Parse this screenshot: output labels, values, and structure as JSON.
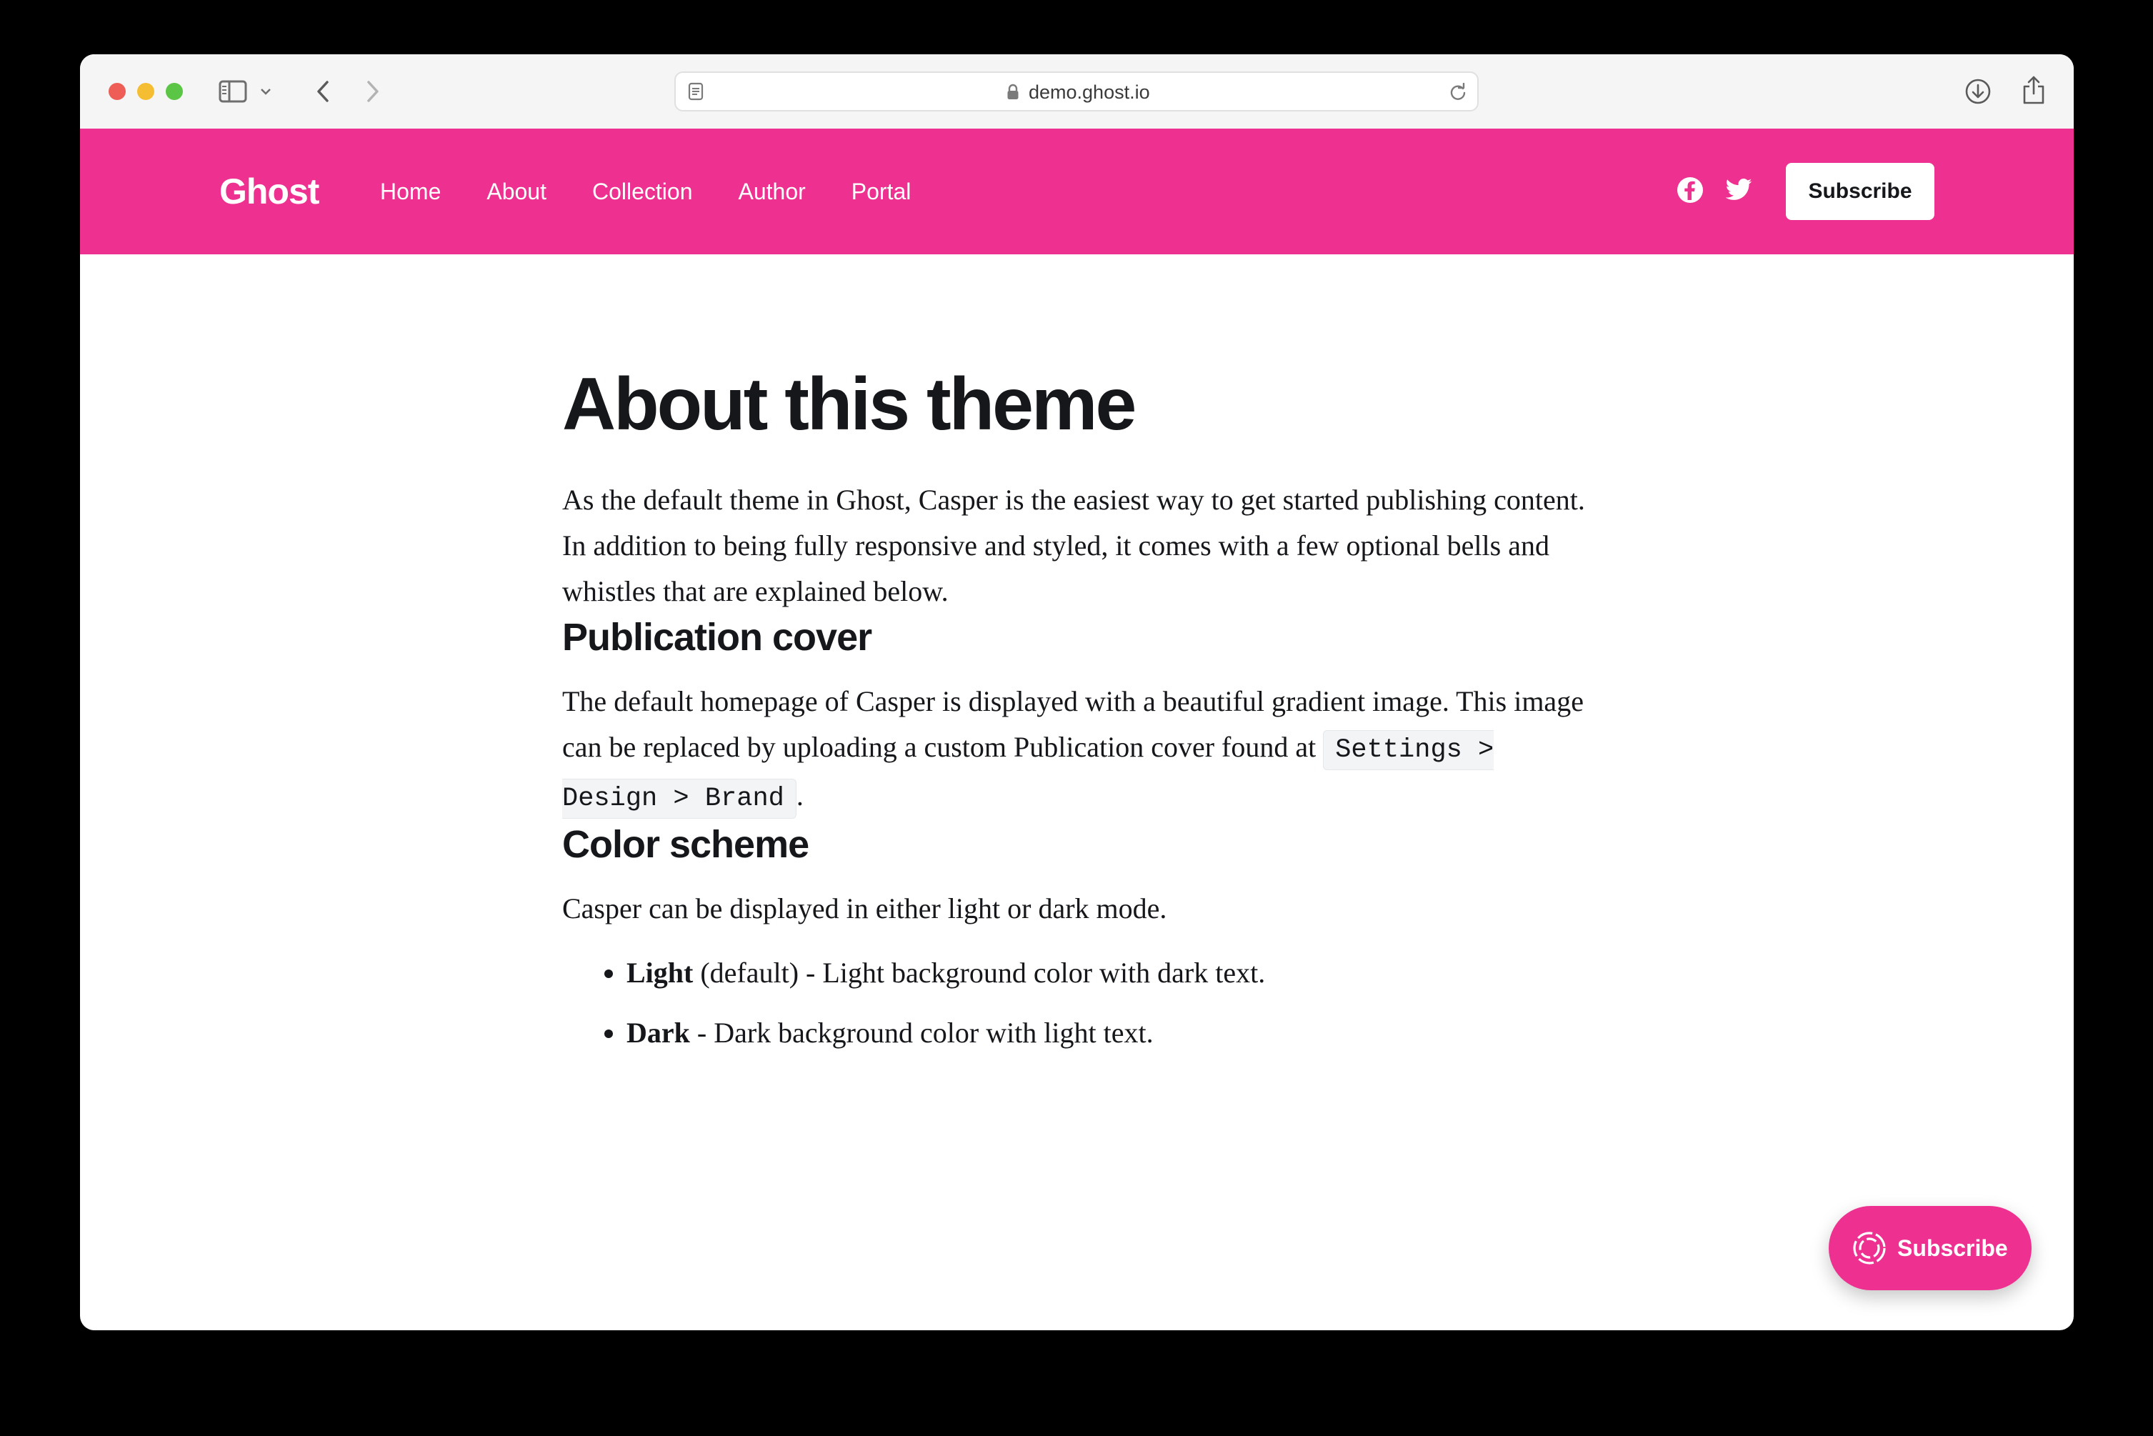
{
  "browser": {
    "url": "demo.ghost.io"
  },
  "site": {
    "logo": "Ghost",
    "nav": [
      "Home",
      "About",
      "Collection",
      "Author",
      "Portal"
    ],
    "subscribe_label": "Subscribe",
    "accent_color": "#ee3190"
  },
  "article": {
    "title": "About this theme",
    "intro": "As the default theme in Ghost, Casper is the easiest way to get started publishing content. In addition to being fully responsive and styled, it comes with a few optional bells and whistles that are explained below.",
    "cover_heading": "Publication cover",
    "cover_text": "The default homepage of Casper is displayed with a beautiful gradient image. This image can be replaced by uploading a custom Publication cover found at",
    "cover_code": "Settings > Design > Brand",
    "cover_end": ".",
    "color_heading": "Color scheme",
    "color_text": "Casper can be displayed in either light or dark mode.",
    "bullets": [
      {
        "bold": "Light",
        "text": " (default) - Light background color with dark text."
      },
      {
        "bold": "Dark",
        "text": " - Dark background color with light text."
      }
    ]
  },
  "portal": {
    "label": "Subscribe"
  }
}
